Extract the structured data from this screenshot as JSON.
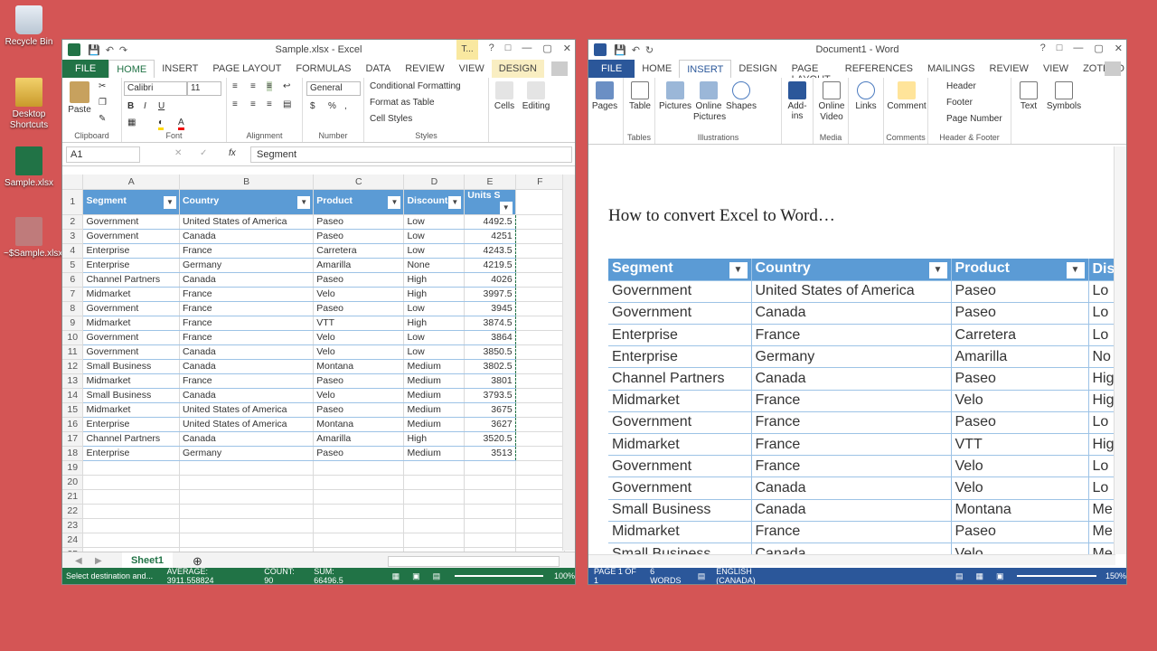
{
  "desktop": {
    "icons": [
      {
        "label": "Recycle Bin"
      },
      {
        "label": "Desktop Shortcuts"
      },
      {
        "label": "Sample.xlsx"
      },
      {
        "label": "~$Sample.xlsx"
      }
    ]
  },
  "excel": {
    "title": "Sample.xlsx - Excel",
    "table_tools": "T...",
    "tabs": [
      "FILE",
      "HOME",
      "INSERT",
      "PAGE LAYOUT",
      "FORMULAS",
      "DATA",
      "REVIEW",
      "VIEW",
      "DESIGN"
    ],
    "ribbon": {
      "paste": "Paste",
      "clipboard": "Clipboard",
      "font_name": "Calibri",
      "font_size": "11",
      "font": "Font",
      "alignment": "Alignment",
      "number_format": "General",
      "number": "Number",
      "cond_fmt": "Conditional Formatting",
      "fmt_table": "Format as Table",
      "cell_styles": "Cell Styles",
      "styles": "Styles",
      "cells": "Cells",
      "editing": "Editing",
      "bold": "B",
      "italic": "I",
      "underline": "U",
      "currency": "$",
      "percent": "%"
    },
    "name_box": "A1",
    "formula": "Segment",
    "fx": "fx",
    "col_letters": [
      "A",
      "B",
      "C",
      "D",
      "E",
      "F"
    ],
    "headers": [
      "Segment",
      "Country",
      "Product",
      "Discount",
      "Units S"
    ],
    "rows": [
      [
        "Government",
        "United States of America",
        "Paseo",
        "Low",
        "4492.5"
      ],
      [
        "Government",
        "Canada",
        "Paseo",
        "Low",
        "4251"
      ],
      [
        "Enterprise",
        "France",
        "Carretera",
        "Low",
        "4243.5"
      ],
      [
        "Enterprise",
        "Germany",
        "Amarilla",
        "None",
        "4219.5"
      ],
      [
        "Channel Partners",
        "Canada",
        "Paseo",
        "High",
        "4026"
      ],
      [
        "Midmarket",
        "France",
        "Velo",
        "High",
        "3997.5"
      ],
      [
        "Government",
        "France",
        "Paseo",
        "Low",
        "3945"
      ],
      [
        "Midmarket",
        "France",
        "VTT",
        "High",
        "3874.5"
      ],
      [
        "Government",
        "France",
        "Velo",
        "Low",
        "3864"
      ],
      [
        "Government",
        "Canada",
        "Velo",
        "Low",
        "3850.5"
      ],
      [
        "Small Business",
        "Canada",
        "Montana",
        "Medium",
        "3802.5"
      ],
      [
        "Midmarket",
        "France",
        "Paseo",
        "Medium",
        "3801"
      ],
      [
        "Small Business",
        "Canada",
        "Velo",
        "Medium",
        "3793.5"
      ],
      [
        "Midmarket",
        "United States of America",
        "Paseo",
        "Medium",
        "3675"
      ],
      [
        "Enterprise",
        "United States of America",
        "Montana",
        "Medium",
        "3627"
      ],
      [
        "Channel Partners",
        "Canada",
        "Amarilla",
        "High",
        "3520.5"
      ],
      [
        "Enterprise",
        "Germany",
        "Paseo",
        "Medium",
        "3513"
      ]
    ],
    "empty_rows": [
      "19",
      "20",
      "21",
      "22",
      "23",
      "24",
      "25"
    ],
    "sheet_tab": "Sheet1",
    "status": {
      "mode": "Select destination and...",
      "average": "AVERAGE: 3911.558824",
      "count": "COUNT: 90",
      "sum": "SUM: 66496.5",
      "zoom": "100%"
    }
  },
  "word": {
    "title": "Document1 - Word",
    "tabs": [
      "FILE",
      "HOME",
      "INSERT",
      "DESIGN",
      "PAGE LAYOUT",
      "REFERENCES",
      "MAILINGS",
      "REVIEW",
      "VIEW",
      "ZOTERO"
    ],
    "ribbon": {
      "pages": "Pages",
      "table": "Table",
      "tables": "Tables",
      "pictures": "Pictures",
      "online_pictures": "Online Pictures",
      "shapes": "Shapes",
      "illustrations": "Illustrations",
      "addins": "Add-ins",
      "online_video": "Online Video",
      "media": "Media",
      "links": "Links",
      "comment": "Comment",
      "comments": "Comments",
      "header": "Header",
      "footer": "Footer",
      "page_number": "Page Number",
      "hf": "Header & Footer",
      "text": "Text",
      "symbols": "Symbols"
    },
    "heading": "How to convert Excel to Word…",
    "headers": [
      "Segment",
      "Country",
      "Product",
      "Dis"
    ],
    "rows": [
      [
        "Government",
        "United States of America",
        "Paseo",
        "Lo"
      ],
      [
        "Government",
        "Canada",
        "Paseo",
        "Lo"
      ],
      [
        "Enterprise",
        "France",
        "Carretera",
        "Lo"
      ],
      [
        "Enterprise",
        "Germany",
        "Amarilla",
        "No"
      ],
      [
        "Channel Partners",
        "Canada",
        "Paseo",
        "Hig"
      ],
      [
        "Midmarket",
        "France",
        "Velo",
        "Hig"
      ],
      [
        "Government",
        "France",
        "Paseo",
        "Lo"
      ],
      [
        "Midmarket",
        "France",
        "VTT",
        "Hig"
      ],
      [
        "Government",
        "France",
        "Velo",
        "Lo"
      ],
      [
        "Government",
        "Canada",
        "Velo",
        "Lo"
      ],
      [
        "Small Business",
        "Canada",
        "Montana",
        "Me"
      ],
      [
        "Midmarket",
        "France",
        "Paseo",
        "Me"
      ],
      [
        "Small Business",
        "Canada",
        "Velo",
        "Me"
      ]
    ],
    "status": {
      "page": "PAGE 1 OF 1",
      "words": "6 WORDS",
      "lang": "ENGLISH (CANADA)",
      "zoom": "150%"
    }
  },
  "colors": {
    "excel_green": "#217346",
    "word_blue": "#2b579a",
    "table_header": "#5b9bd5"
  }
}
